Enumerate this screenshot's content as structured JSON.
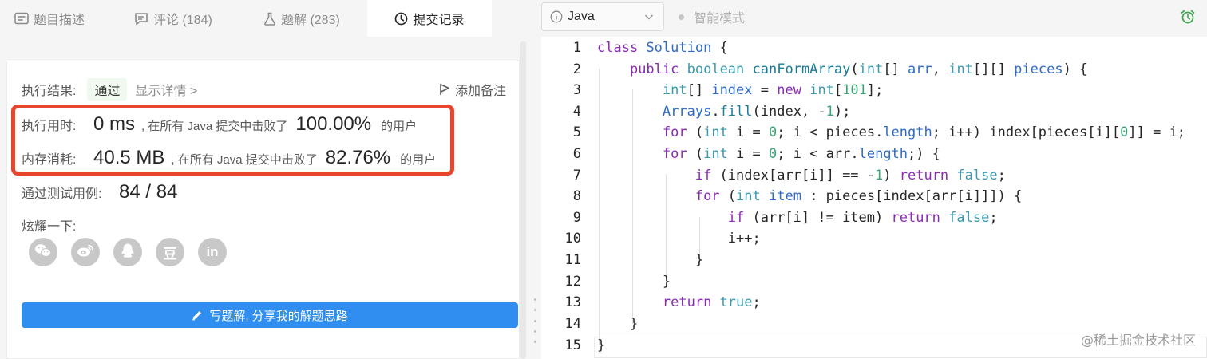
{
  "tabs": [
    {
      "label": "题目描述",
      "icon": "description-icon"
    },
    {
      "label": "评论 (184)",
      "icon": "comment-icon"
    },
    {
      "label": "题解 (283)",
      "icon": "flask-icon"
    },
    {
      "label": "提交记录",
      "icon": "clock-icon",
      "active": true
    }
  ],
  "result": {
    "label": "执行结果:",
    "status": "通过",
    "details": "显示详情 >",
    "note_label": "添加备注"
  },
  "runtime": {
    "label": "执行用时:",
    "value": "0 ms",
    "middle": ", 在所有 Java 提交中击败了",
    "percent": "100.00%",
    "suffix": "的用户"
  },
  "memory": {
    "label": "内存消耗:",
    "value": "40.5 MB",
    "middle": ", 在所有 Java 提交中击败了",
    "percent": "82.76%",
    "suffix": "的用户"
  },
  "testcases": {
    "label": "通过测试用例:",
    "value": "84 / 84"
  },
  "share": {
    "label": "炫耀一下:",
    "buttons": [
      "wechat-icon",
      "weibo-icon",
      "qq-icon",
      "douban-icon",
      "linkedin-icon"
    ],
    "douban_text": "豆",
    "linkedin_text": "in"
  },
  "write_button": "写题解, 分享我的解题思路",
  "editor": {
    "language": "Java",
    "smart_mode": "智能模式",
    "accent": "#2f8ef0",
    "highlight": "#e8452d",
    "lines": [
      "1",
      "2",
      "3",
      "4",
      "5",
      "6",
      "7",
      "8",
      "9",
      "10",
      "11",
      "12",
      "13",
      "14",
      "15"
    ]
  },
  "watermark": "@稀土掘金技术社区"
}
